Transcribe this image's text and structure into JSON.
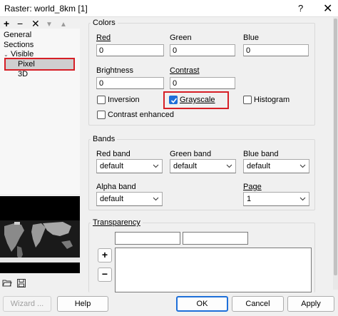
{
  "window": {
    "title": "Raster: world_8km [1]",
    "help_glyph": "?",
    "close_glyph": "✕"
  },
  "toolbar": {
    "add": "+",
    "remove": "−",
    "delete": "✕",
    "down": "▼",
    "up": "▲"
  },
  "tree": {
    "items": [
      "General",
      "Sections",
      "Visible",
      "Pixel",
      "3D"
    ],
    "selected": "Pixel"
  },
  "colors_group": {
    "title": "Colors",
    "red_label": "Red",
    "red_value": "0",
    "green_label": "Green",
    "green_value": "0",
    "blue_label": "Blue",
    "blue_value": "0",
    "brightness_label": "Brightness",
    "brightness_value": "0",
    "contrast_label": "Contrast",
    "contrast_value": "0",
    "inversion_label": "Inversion",
    "inversion_checked": false,
    "grayscale_label": "Grayscale",
    "grayscale_checked": true,
    "histogram_label": "Histogram",
    "histogram_checked": false,
    "contrast_enhanced_label": "Contrast enhanced",
    "contrast_enhanced_checked": false
  },
  "bands_group": {
    "title": "Bands",
    "red_band_label": "Red band",
    "red_band_value": "default",
    "green_band_label": "Green band",
    "green_band_value": "default",
    "blue_band_label": "Blue band",
    "blue_band_value": "default",
    "alpha_band_label": "Alpha band",
    "alpha_band_value": "default",
    "page_label": "Page",
    "page_value": "1"
  },
  "transparency_group": {
    "title": "Transparency",
    "add_glyph": "+",
    "remove_glyph": "−"
  },
  "footer": {
    "wizard_label": "Wizard ...",
    "help_label": "Help",
    "ok_label": "OK",
    "cancel_label": "Cancel",
    "apply_label": "Apply"
  },
  "colors": {
    "highlight": "#d61f26",
    "accent": "#1e6fd9"
  }
}
